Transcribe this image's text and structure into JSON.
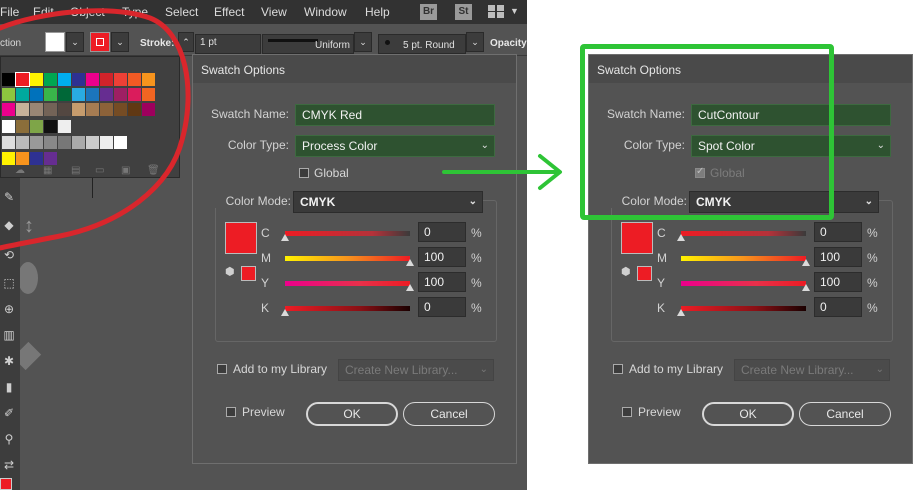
{
  "menubar": {
    "items": [
      "File",
      "Edit",
      "Object",
      "Type",
      "Select",
      "Effect",
      "View",
      "Window",
      "Help"
    ],
    "br_label": "Br",
    "st_label": "St"
  },
  "controlbar": {
    "selection_label": "ction",
    "stroke_label": "Stroke:",
    "stroke_weight": "1 pt",
    "profile": "Uniform",
    "brush": "5 pt. Round",
    "opacity_label": "Opacity:"
  },
  "colors": {
    "annotation_red": "#d9262c",
    "annotation_green": "#2ec436",
    "swatch_red": "#ed1c24",
    "dialog_bg": "#535353"
  },
  "dialogs": [
    {
      "title": "Swatch Options",
      "swatch_name_label": "Swatch Name:",
      "swatch_name": "CMYK Red",
      "color_type_label": "Color Type:",
      "color_type": "Process Color",
      "global_label": "Global",
      "global_checked": false,
      "global_disabled": false,
      "color_mode_label": "Color Mode:",
      "color_mode": "CMYK",
      "channels": [
        {
          "key": "C",
          "value": "0",
          "level": 0,
          "pct": "%"
        },
        {
          "key": "M",
          "value": "100",
          "level": 100,
          "pct": "%"
        },
        {
          "key": "Y",
          "value": "100",
          "level": 100,
          "pct": "%"
        },
        {
          "key": "K",
          "value": "0",
          "level": 0,
          "pct": "%"
        }
      ],
      "add_library_label": "Add to my Library",
      "library_placeholder": "Create New Library...",
      "preview_label": "Preview",
      "ok_label": "OK",
      "cancel_label": "Cancel"
    },
    {
      "title": "Swatch Options",
      "swatch_name_label": "Swatch Name:",
      "swatch_name": "CutContour",
      "color_type_label": "Color Type:",
      "color_type": "Spot Color",
      "global_label": "Global",
      "global_checked": true,
      "global_disabled": true,
      "color_mode_label": "Color Mode:",
      "color_mode": "CMYK",
      "channels": [
        {
          "key": "C",
          "value": "0",
          "level": 0,
          "pct": "%"
        },
        {
          "key": "M",
          "value": "100",
          "level": 100,
          "pct": "%"
        },
        {
          "key": "Y",
          "value": "100",
          "level": 100,
          "pct": "%"
        },
        {
          "key": "K",
          "value": "0",
          "level": 0,
          "pct": "%"
        }
      ],
      "add_library_label": "Add to my Library",
      "library_placeholder": "Create New Library...",
      "preview_label": "Preview",
      "ok_label": "OK",
      "cancel_label": "Cancel"
    }
  ]
}
